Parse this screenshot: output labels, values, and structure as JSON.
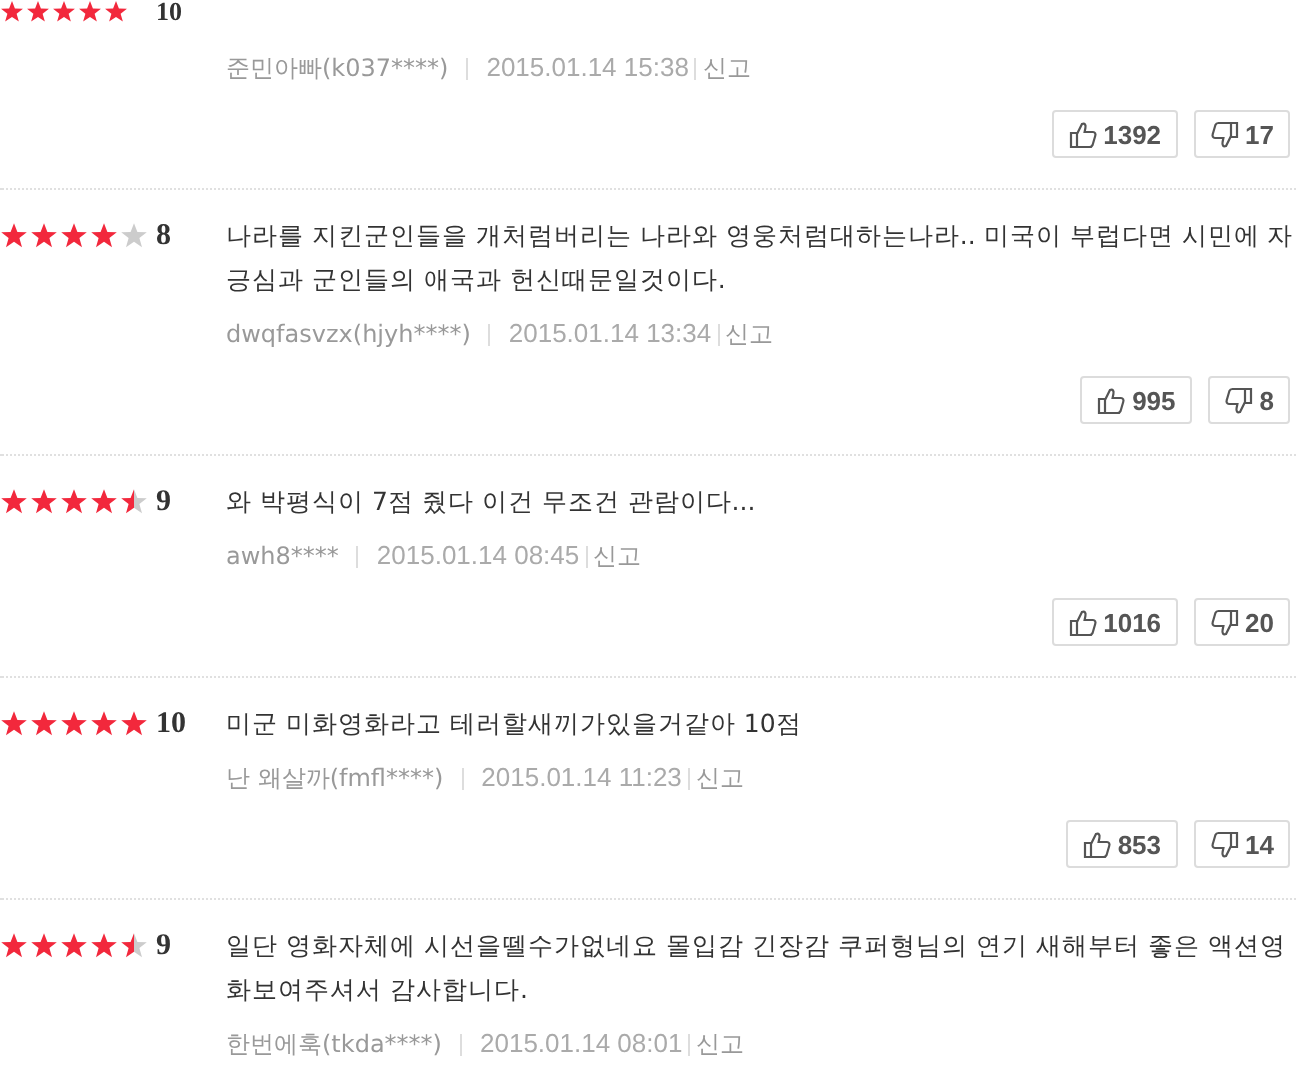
{
  "reviews": [
    {
      "stars": 5,
      "score": "10",
      "author": "준민아빠(k037****)",
      "date": "2015.01.14 15:38",
      "report": "신고",
      "likes": "1392",
      "dislikes": "17"
    },
    {
      "stars": 4,
      "score": "8",
      "lines": [
        "나라를 지킨군인들을 개처럼버리는 나라와 영웅처럼대하는나라.. 미국이 부럽다면 시민에 자",
        "긍심과 군인들의 애국과 헌신때문일것이다."
      ],
      "author": "dwqfasvzx(hjyh****)",
      "date": "2015.01.14 13:34",
      "report": "신고",
      "likes": "995",
      "dislikes": "8"
    },
    {
      "stars": 4.5,
      "score": "9",
      "lines": [
        "와 박평식이 7점 줬다 이건 무조건 관람이다..."
      ],
      "author": "awh8****",
      "date": "2015.01.14 08:45",
      "report": "신고",
      "likes": "1016",
      "dislikes": "20"
    },
    {
      "stars": 5,
      "score": "10",
      "lines": [
        "미군 미화영화라고 테러할새끼가있을거같아 10점"
      ],
      "author": "난 왜살까(fmfl****)",
      "date": "2015.01.14 11:23",
      "report": "신고",
      "likes": "853",
      "dislikes": "14"
    },
    {
      "stars": 4.5,
      "score": "9",
      "lines": [
        "일단 영화자체에 시선을뗄수가없네요 몰입감 긴장감 쿠퍼형님의 연기 새해부터 좋은 액션영",
        "화보여주셔서 감사합니다."
      ],
      "author": "한번에훅(tkda****)",
      "date": "2015.01.14 08:01",
      "report": "신고"
    }
  ]
}
